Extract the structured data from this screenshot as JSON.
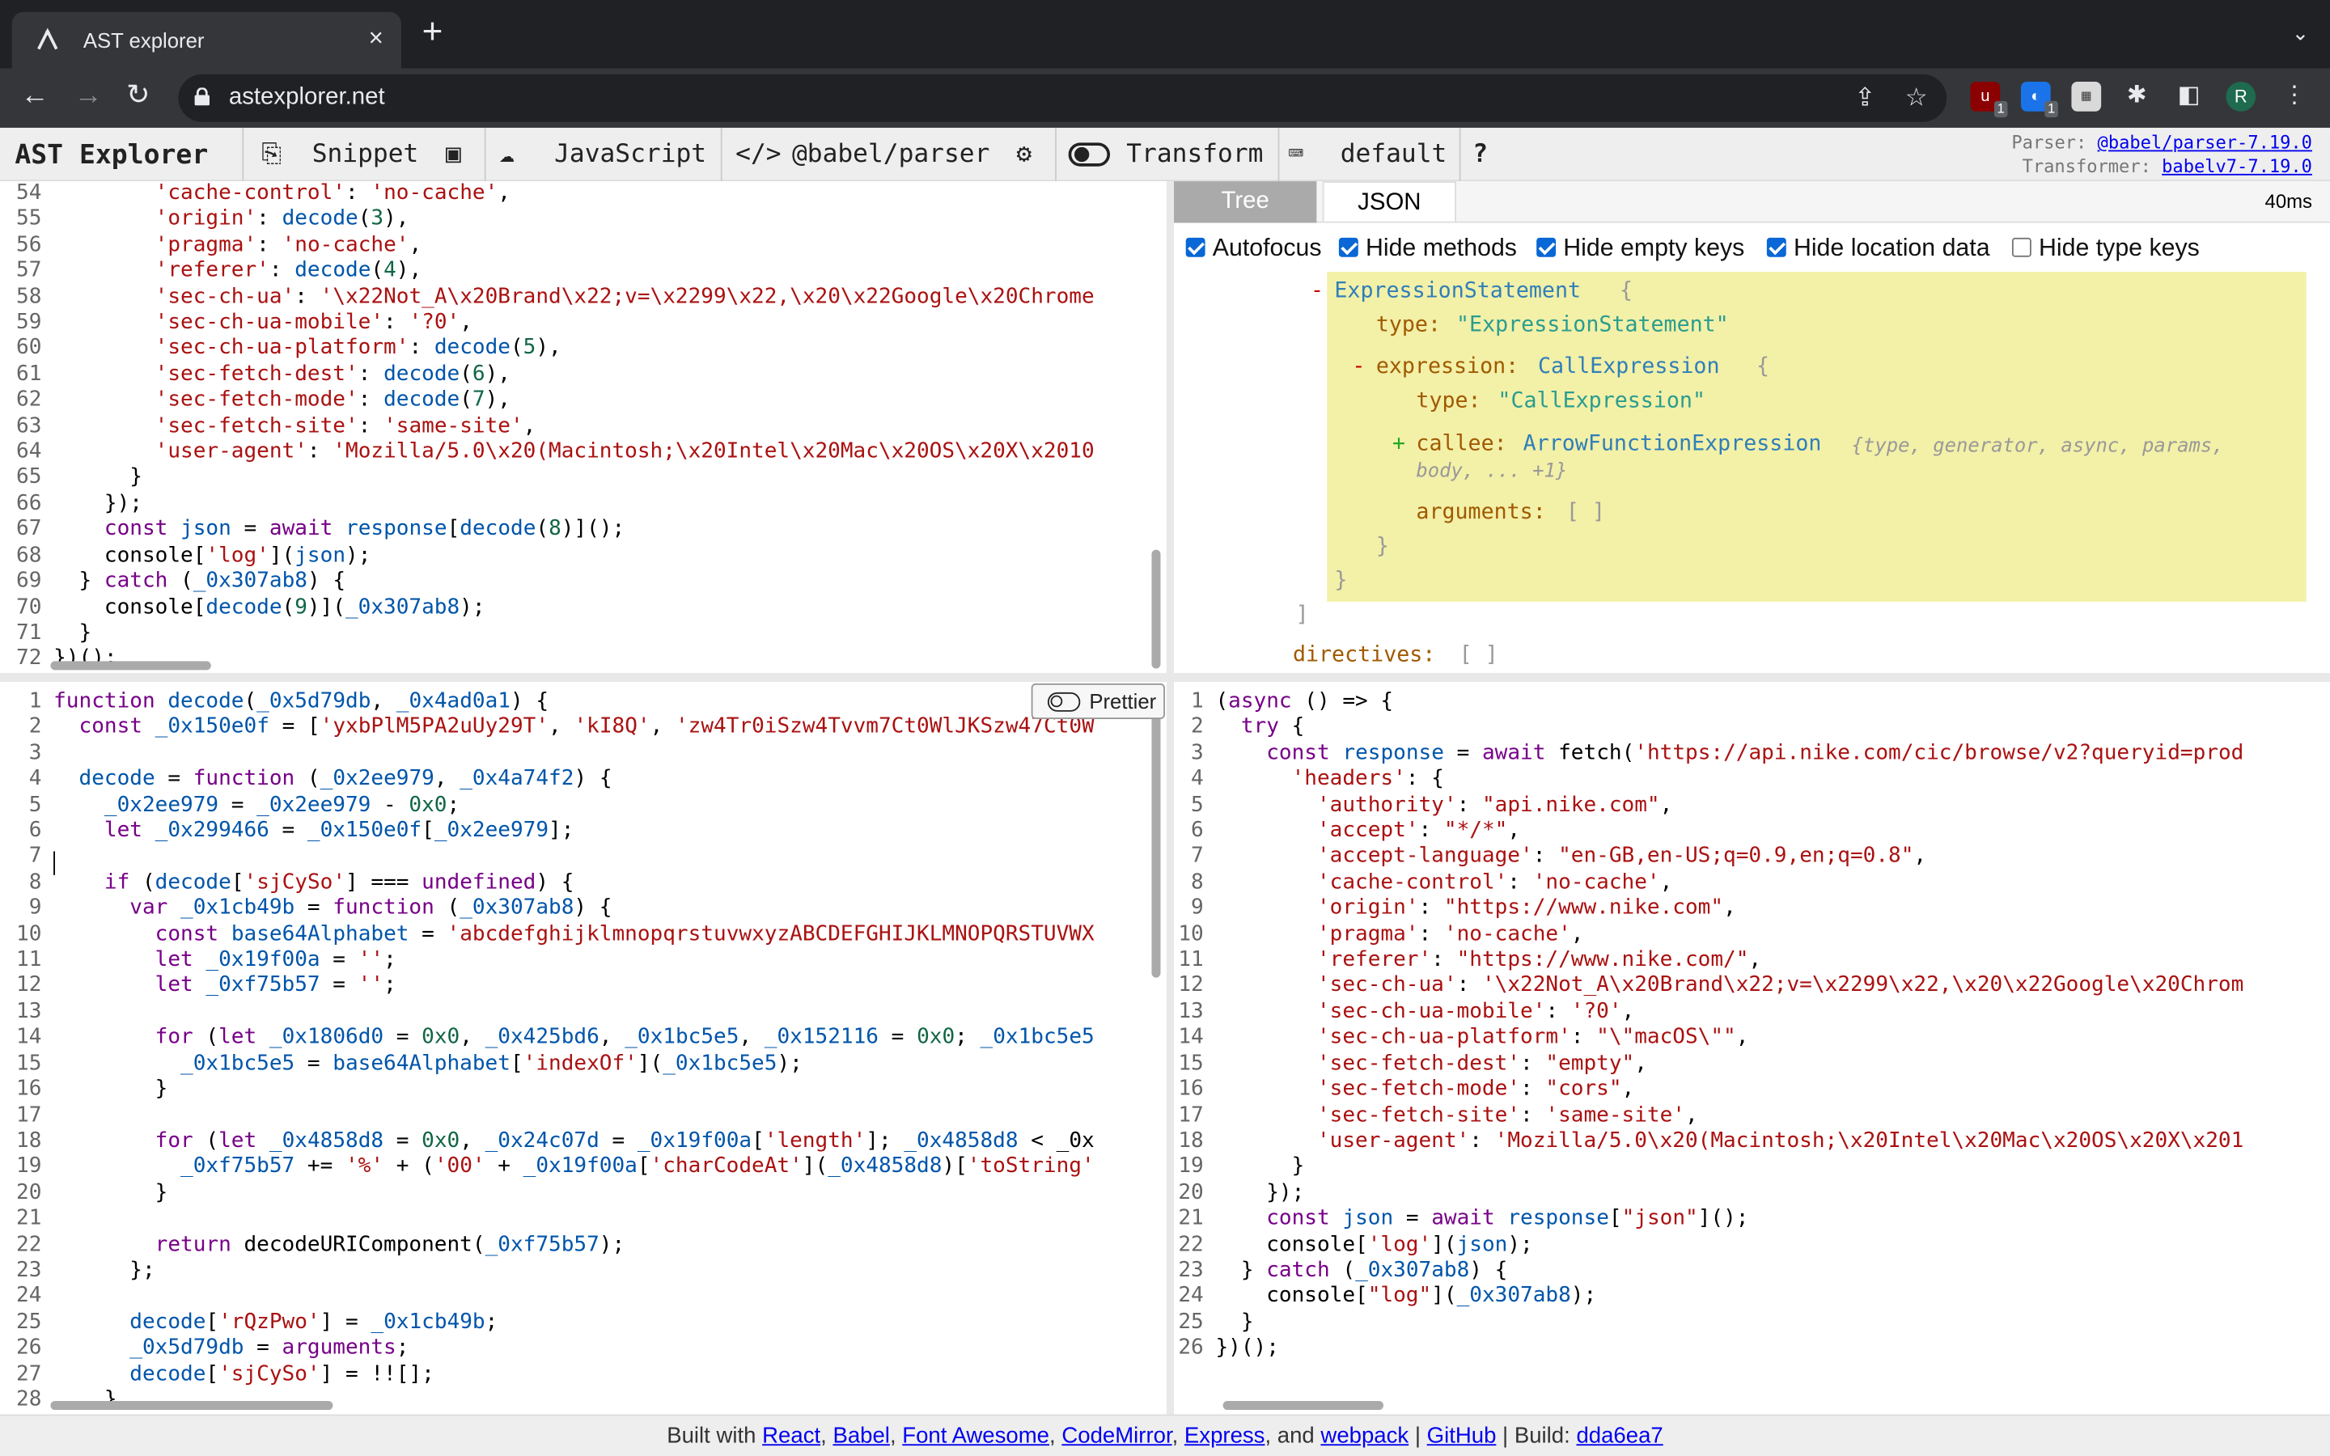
{
  "browser": {
    "tab_title": "AST explorer",
    "url": "astexplorer.net",
    "profile_initial": "R",
    "ext_badges": [
      "1",
      "1"
    ]
  },
  "toolbar": {
    "brand": "AST Explorer",
    "snippet": "Snippet",
    "language": "JavaScript",
    "parser": "@babel/parser",
    "transform": "Transform",
    "keymap": "default",
    "help": "?",
    "parser_label": "Parser:",
    "parser_value": "@babel/parser-7.19.0",
    "transformer_label": "Transformer:",
    "transformer_value": "babelv7-7.19.0"
  },
  "output": {
    "tabs": [
      "Tree",
      "JSON"
    ],
    "time": "40ms",
    "options": [
      {
        "label": "Autofocus",
        "checked": true
      },
      {
        "label": "Hide methods",
        "checked": true
      },
      {
        "label": "Hide empty keys",
        "checked": true
      },
      {
        "label": "Hide location data",
        "checked": true
      },
      {
        "label": "Hide type keys",
        "checked": false
      }
    ]
  },
  "tree": {
    "node1": "ExpressionStatement",
    "brace_open": "{",
    "brace_close": "}",
    "type_key": "type:",
    "type1": "\"ExpressionStatement\"",
    "expr_key": "expression:",
    "expr_type": "CallExpression",
    "type2": "\"CallExpression\"",
    "callee_key": "callee:",
    "callee_type": "ArrowFunctionExpression",
    "callee_summary": "{type, generator, async, params,",
    "callee_summary2": "body, ... +1}",
    "arguments_key": "arguments:",
    "empty_array": "[ ]",
    "bracket_close": "]",
    "directives_key": "directives:",
    "minus": "-",
    "plus": "+"
  },
  "prettier_label": "Prettier",
  "editor_top_lines": [
    "        'cache-control': 'no-cache',",
    "        'origin': decode(3),",
    "        'pragma': 'no-cache',",
    "        'referer': decode(4),",
    "        'sec-ch-ua': '\\x22Not_A\\x20Brand\\x22;v=\\x2299\\x22,\\x20\\x22Google\\x20Chrome",
    "        'sec-ch-ua-mobile': '?0',",
    "        'sec-ch-ua-platform': decode(5),",
    "        'sec-fetch-dest': decode(6),",
    "        'sec-fetch-mode': decode(7),",
    "        'sec-fetch-site': 'same-site',",
    "        'user-agent': 'Mozilla/5.0\\x20(Macintosh;\\x20Intel\\x20Mac\\x20OS\\x20X\\x2010",
    "      }",
    "    });",
    "    const json = await response[decode(8)]();",
    "    console['log'](json);",
    "  } catch (_0x307ab8) {",
    "    console[decode(9)](_0x307ab8);",
    "  }",
    "})();"
  ],
  "editor_top_start": 54,
  "editor_bottom_lines": [
    "function decode(_0x5d79db, _0x4ad0a1) {",
    "  const _0x150e0f = ['yxbPlM5PA2uUy29T', 'kI8Q', 'zw4Tr0iSzw4Tvvm7Ct0WlJKSzw47Ct0W",
    "",
    "  decode = function (_0x2ee979, _0x4a74f2) {",
    "    _0x2ee979 = _0x2ee979 - 0x0;",
    "    let _0x299466 = _0x150e0f[_0x2ee979];",
    "",
    "    if (decode['sjCySo'] === undefined) {",
    "      var _0x1cb49b = function (_0x307ab8) {",
    "        const base64Alphabet = 'abcdefghijklmnopqrstuvwxyzABCDEFGHIJKLMNOPQRSTUVWX",
    "        let _0x19f00a = '';",
    "        let _0xf75b57 = '';",
    "",
    "        for (let _0x1806d0 = 0x0, _0x425bd6, _0x1bc5e5, _0x152116 = 0x0; _0x1bc5e5",
    "          _0x1bc5e5 = base64Alphabet['indexOf'](_0x1bc5e5);",
    "        }",
    "",
    "        for (let _0x4858d8 = 0x0, _0x24c07d = _0x19f00a['length']; _0x4858d8 < _0x",
    "          _0xf75b57 += '%' + ('00' + _0x19f00a['charCodeAt'](_0x4858d8)['toString'",
    "        }",
    "",
    "        return decodeURIComponent(_0xf75b57);",
    "      };",
    "",
    "      decode['rQzPwo'] = _0x1cb49b;",
    "      _0x5d79db = arguments;",
    "      decode['sjCySo'] = !![];",
    "    }"
  ],
  "output_lines": [
    "(async () => {",
    "  try {",
    "    const response = await fetch('https://api.nike.com/cic/browse/v2?queryid=prod",
    "      'headers': {",
    "        'authority': \"api.nike.com\",",
    "        'accept': \"*/*\",",
    "        'accept-language': \"en-GB,en-US;q=0.9,en;q=0.8\",",
    "        'cache-control': 'no-cache',",
    "        'origin': \"https://www.nike.com\",",
    "        'pragma': 'no-cache',",
    "        'referer': \"https://www.nike.com/\",",
    "        'sec-ch-ua': '\\x22Not_A\\x20Brand\\x22;v=\\x2299\\x22,\\x20\\x22Google\\x20Chrom",
    "        'sec-ch-ua-mobile': '?0',",
    "        'sec-ch-ua-platform': \"\\\"macOS\\\"\",",
    "        'sec-fetch-dest': \"empty\",",
    "        'sec-fetch-mode': \"cors\",",
    "        'sec-fetch-site': 'same-site',",
    "        'user-agent': 'Mozilla/5.0\\x20(Macintosh;\\x20Intel\\x20Mac\\x20OS\\x20X\\x201",
    "      }",
    "    });",
    "    const json = await response[\"json\"]();",
    "    console['log'](json);",
    "  } catch (_0x307ab8) {",
    "    console[\"log\"](_0x307ab8);",
    "  }",
    "})();"
  ],
  "footer": {
    "built_with": "Built with",
    "links": [
      "React",
      "Babel",
      "Font Awesome",
      "CodeMirror",
      "Express"
    ],
    "and": "and",
    "webpack": "webpack",
    "github": "GitHub",
    "build_label": "Build:",
    "build": "dda6ea7"
  },
  "colors": {
    "accent": "#0a67d6",
    "highlight": "#f3f0a8",
    "string": "#a11",
    "keyword": "#708"
  }
}
